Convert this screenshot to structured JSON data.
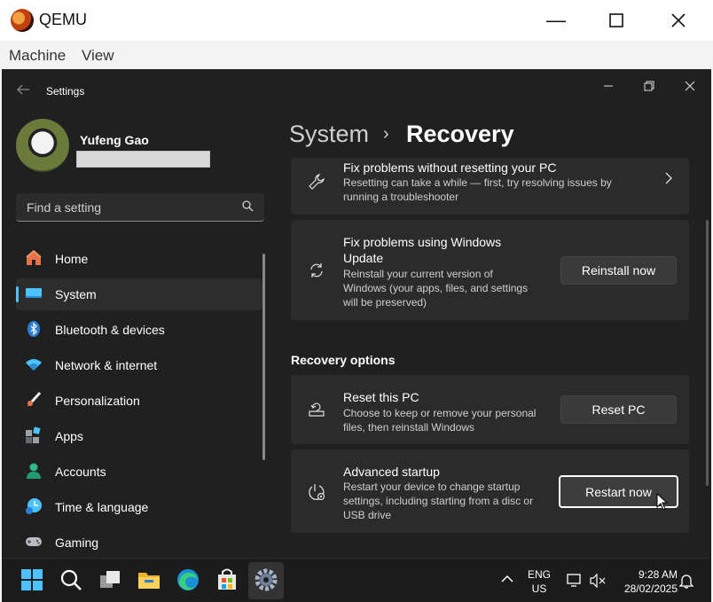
{
  "qemu": {
    "title": "QEMU",
    "menu": [
      "Machine",
      "View"
    ],
    "controls": {
      "minimize": "—",
      "maximize": "☐",
      "close": "✕"
    }
  },
  "settings_window": {
    "title": "Settings",
    "back_icon": "back-arrow-icon",
    "controls": {
      "minimize": "—",
      "restore": "❐",
      "close": "✕"
    }
  },
  "profile": {
    "name": "Yufeng Gao"
  },
  "search": {
    "placeholder": "Find a setting"
  },
  "nav": [
    {
      "label": "Home",
      "icon": "home-icon"
    },
    {
      "label": "System",
      "icon": "system-icon",
      "selected": true
    },
    {
      "label": "Bluetooth & devices",
      "icon": "bluetooth-icon"
    },
    {
      "label": "Network & internet",
      "icon": "wifi-icon"
    },
    {
      "label": "Personalization",
      "icon": "brush-icon"
    },
    {
      "label": "Apps",
      "icon": "apps-icon"
    },
    {
      "label": "Accounts",
      "icon": "person-icon"
    },
    {
      "label": "Time & language",
      "icon": "clock-icon"
    },
    {
      "label": "Gaming",
      "icon": "gamepad-icon"
    }
  ],
  "breadcrumb": {
    "parent": "System",
    "separator": "›",
    "current": "Recovery"
  },
  "cards": {
    "fix_problems": {
      "title": "Fix problems without resetting your PC",
      "desc1": "Resetting can take a while — first, try resolving issues by",
      "desc2": "running a troubleshooter"
    },
    "windows_update": {
      "title1": "Fix problems using Windows",
      "title2": "Update",
      "desc1": "Reinstall your current version of",
      "desc2": "Windows (your apps, files, and settings",
      "desc3": "will be preserved)",
      "button": "Reinstall now"
    },
    "section_label": "Recovery options",
    "reset_pc": {
      "title": "Reset this PC",
      "desc1": "Choose to keep or remove your personal",
      "desc2": "files, then reinstall Windows",
      "button": "Reset PC"
    },
    "advanced_startup": {
      "title": "Advanced startup",
      "desc1": "Restart your device to change startup",
      "desc2": "settings, including starting from a disc or",
      "desc3": "USB drive",
      "button": "Restart now"
    }
  },
  "taskbar": {
    "apps": [
      "start-icon",
      "search-icon",
      "task-view-icon",
      "file-explorer-icon",
      "edge-icon",
      "store-icon",
      "settings-icon"
    ],
    "lang1": "ENG",
    "lang2": "US",
    "time": "9:28 AM",
    "date": "28/02/2025"
  }
}
